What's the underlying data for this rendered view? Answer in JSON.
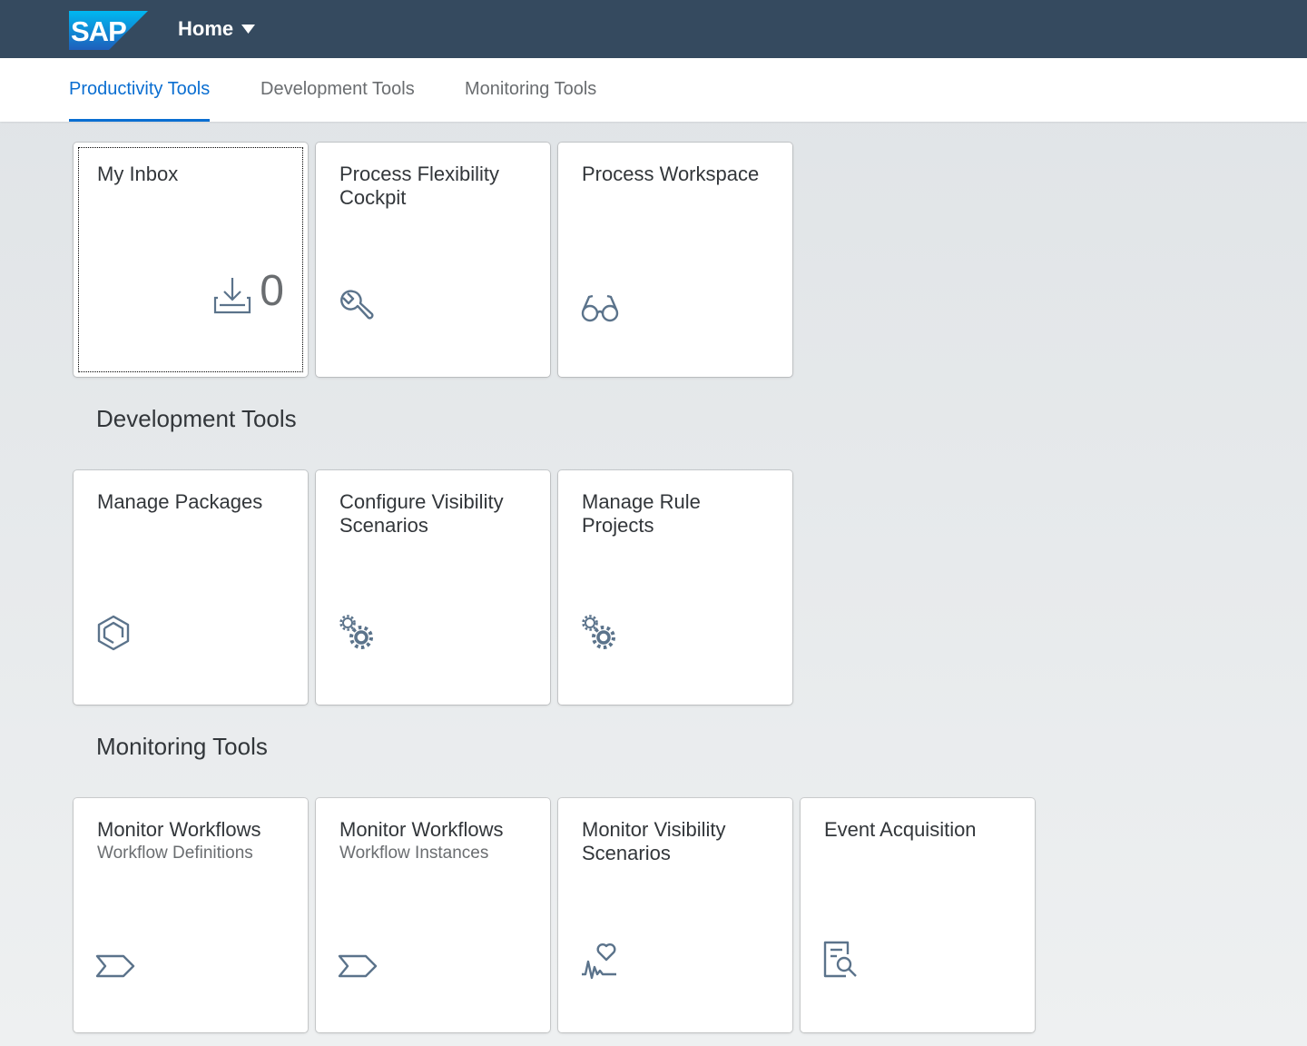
{
  "shell": {
    "logo_text": "SAP",
    "menu_label": "Home"
  },
  "tabs": [
    {
      "label": "Productivity Tools",
      "active": true
    },
    {
      "label": "Development Tools",
      "active": false
    },
    {
      "label": "Monitoring Tools",
      "active": false
    }
  ],
  "sections": {
    "productivity": {
      "tiles": [
        {
          "title": "My Inbox",
          "icon": "inbox-download-icon",
          "kpi": "0"
        },
        {
          "title": "Process Flexibility Cockpit",
          "icon": "wrench-icon"
        },
        {
          "title": "Process Workspace",
          "icon": "glasses-icon"
        }
      ]
    },
    "development": {
      "title": "Development Tools",
      "tiles": [
        {
          "title": "Manage Packages",
          "icon": "package-icon"
        },
        {
          "title": "Configure Visibility Scenarios",
          "icon": "gears-icon"
        },
        {
          "title": "Manage Rule Projects",
          "icon": "gears-icon"
        }
      ]
    },
    "monitoring": {
      "title": "Monitoring Tools",
      "tiles": [
        {
          "title": "Monitor Workflows",
          "subtitle": "Workflow Definitions",
          "icon": "process-tag-icon"
        },
        {
          "title": "Monitor Workflows",
          "subtitle": "Workflow Instances",
          "icon": "process-tag-icon"
        },
        {
          "title": "Monitor Visibility Scenarios",
          "icon": "heart-monitor-icon"
        },
        {
          "title": "Event Acquisition",
          "icon": "document-search-icon"
        }
      ]
    }
  },
  "colors": {
    "shell": "#354a5f",
    "accent": "#0a6ed1",
    "icon": "#5b738b"
  }
}
